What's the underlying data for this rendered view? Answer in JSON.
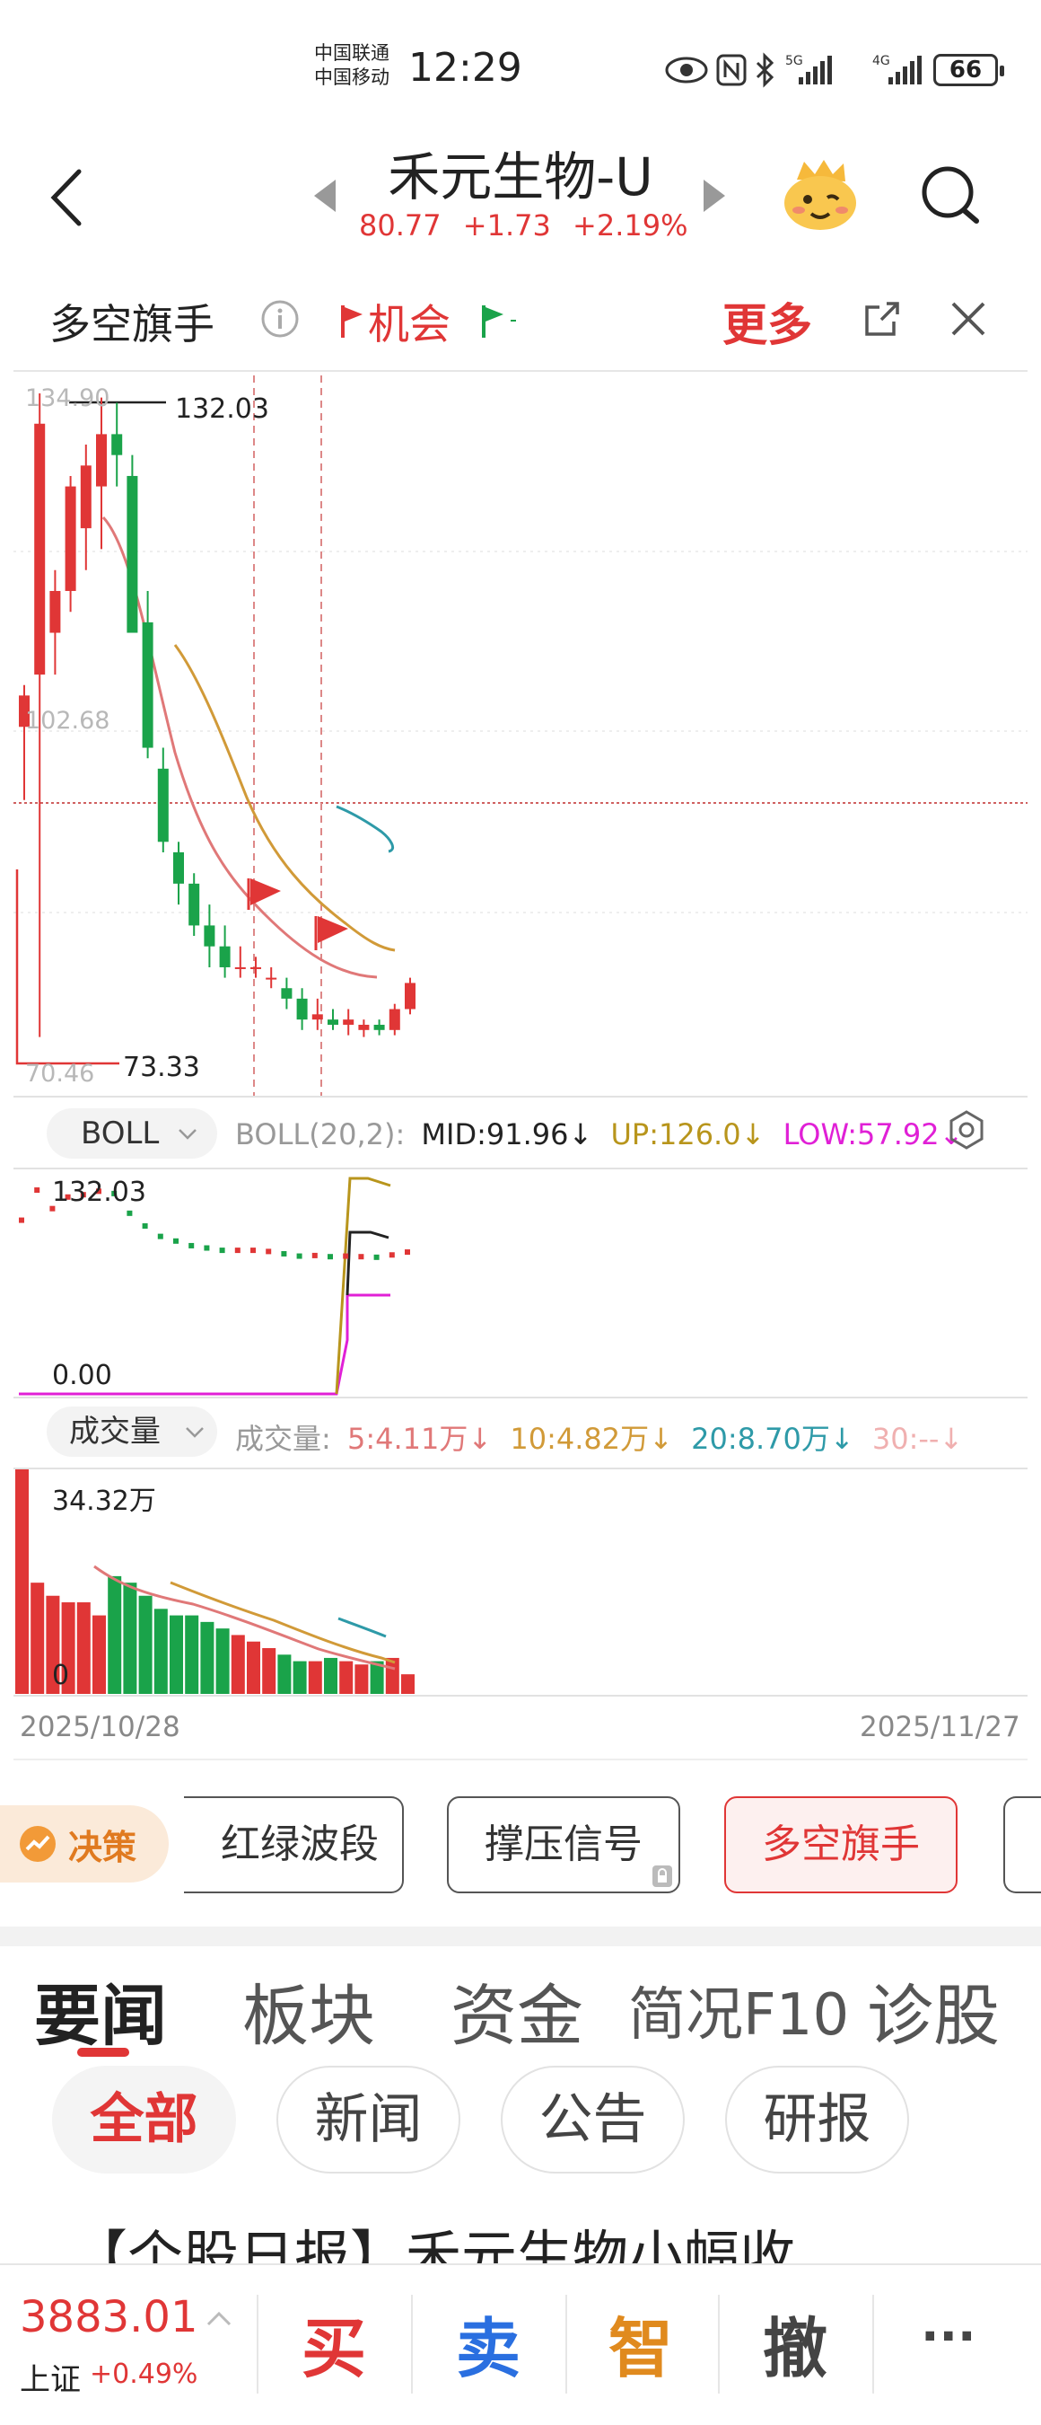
{
  "status_bar": {
    "carrier1": "中国联通",
    "carrier2": "中国移动",
    "time": "12:29",
    "network1": "5G",
    "network2": "4G",
    "battery": "66"
  },
  "header": {
    "title": "禾元生物-U",
    "price": "80.77",
    "change": "+1.73",
    "change_pct": "+2.19%"
  },
  "indicator_bar": {
    "title": "多空旗手",
    "chance_label": "机会",
    "more_label": "更多"
  },
  "chart_main": {
    "axis_high": "134.90",
    "axis_mid": "102.68",
    "axis_low": "70.46",
    "max_label": "132.03",
    "min_label": "73.33"
  },
  "boll": {
    "selector": "BOLL",
    "params": "BOLL(20,2):",
    "mid": "MID:91.96",
    "up": "UP:126.0",
    "low": "LOW:57.92",
    "colors": {
      "mid": "#222222",
      "up": "#b8951c",
      "low": "#e020d6"
    },
    "panel_high": "132.03",
    "panel_low": "0.00"
  },
  "volume": {
    "selector": "成交量",
    "label": "成交量:",
    "ma5": "5:4.11万",
    "ma10": "10:4.82万",
    "ma20": "20:8.70万",
    "ma30": "30:--",
    "colors": {
      "ma5": "#e07878",
      "ma10": "#d19a38",
      "ma20": "#2e9aa8",
      "ma30": "#f0b0b0"
    },
    "max_label": "34.32万",
    "zero_label": "0"
  },
  "dates": {
    "start": "2025/10/28",
    "end": "2025/11/27"
  },
  "strategies": {
    "decision": "决策",
    "items": [
      "红绿波段",
      "撑压信号",
      "多空旗手"
    ]
  },
  "tabs": [
    "要闻",
    "板块",
    "资金",
    "简况F10",
    "诊股"
  ],
  "chips": [
    "全部",
    "新闻",
    "公告",
    "研报"
  ],
  "news_title": "【个股日报】禾元生物小幅收",
  "bottom": {
    "index_value": "3883.01",
    "index_name": "上证",
    "index_change": "+0.49%",
    "actions": [
      "买",
      "卖",
      "智",
      "撤",
      "···"
    ]
  },
  "chart_data": {
    "type": "candlestick",
    "dates": [
      "2025/10/28",
      "2025/11/27"
    ],
    "ohlc": [
      [
        103,
        107,
        96,
        106
      ],
      [
        108,
        134.9,
        73.33,
        132
      ],
      [
        112,
        118,
        108,
        116
      ],
      [
        116,
        127,
        114,
        126
      ],
      [
        122,
        130,
        118,
        128
      ],
      [
        126,
        134.5,
        120,
        131
      ],
      [
        131,
        134,
        126,
        129
      ],
      [
        127,
        129,
        114,
        112
      ],
      [
        113,
        116,
        100,
        101
      ],
      [
        99,
        101,
        91,
        92
      ],
      [
        91,
        92,
        86,
        88
      ],
      [
        88,
        89,
        83,
        84
      ],
      [
        84,
        86,
        80,
        82
      ],
      [
        82,
        84,
        79,
        80
      ],
      [
        80,
        82,
        79,
        80
      ],
      [
        80,
        81,
        79,
        80
      ],
      [
        79,
        80,
        78,
        79
      ],
      [
        78,
        79,
        76,
        77
      ],
      [
        77,
        78,
        74,
        75
      ],
      [
        75,
        77,
        74,
        75.5
      ],
      [
        75,
        76,
        74,
        74.5
      ],
      [
        74.5,
        76,
        73.5,
        75
      ],
      [
        74,
        75,
        73.33,
        74.5
      ],
      [
        74.5,
        75,
        73.5,
        74
      ],
      [
        74,
        76.5,
        73.5,
        76
      ],
      [
        76,
        79,
        75.5,
        78.5
      ]
    ],
    "volume": [
      34.32,
      17,
      15,
      14,
      14,
      12,
      18,
      17,
      15,
      13,
      12,
      12,
      11,
      10,
      9,
      8,
      7,
      6,
      5,
      5,
      5.5,
      5,
      4.5,
      5,
      5.5,
      3
    ]
  }
}
